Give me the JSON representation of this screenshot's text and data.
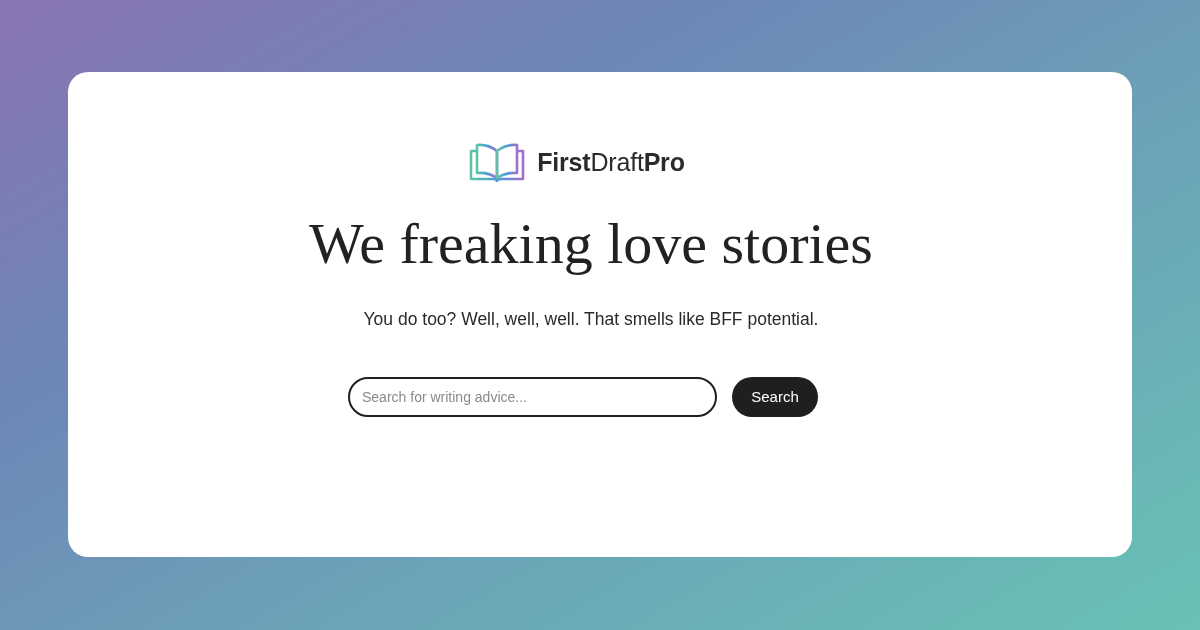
{
  "logo": {
    "name": "**First**Draft**Pro**"
  },
  "headline": "We freaking love stories",
  "tagline": "You do too? Well, well, well. That smells like BFF potential.",
  "search": {
    "placeholder": "Search for writing advice...",
    "button": "Search"
  }
}
